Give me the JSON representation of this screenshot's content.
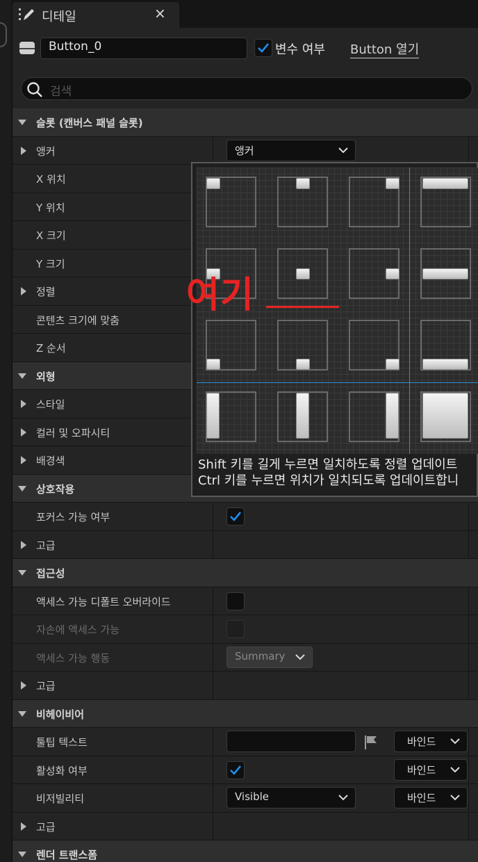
{
  "tab": {
    "title": "디테일",
    "close": "×"
  },
  "header": {
    "name_value": "Button_0",
    "is_variable_label": "변수 여부",
    "is_variable_checked": true,
    "open_link": "Button 열기"
  },
  "search": {
    "placeholder": "검색"
  },
  "rows": [
    {
      "label": "슬롯 (캔버스 패널 슬롯)",
      "kind": "category",
      "expanded": true
    },
    {
      "label": "앵커",
      "kind": "group",
      "control": "combo",
      "value": "앵커"
    },
    {
      "label": "X 위치",
      "kind": "prop"
    },
    {
      "label": "Y 위치",
      "kind": "prop"
    },
    {
      "label": "X 크기",
      "kind": "prop"
    },
    {
      "label": "Y 크기",
      "kind": "prop"
    },
    {
      "label": "정렬",
      "kind": "group"
    },
    {
      "label": "콘텐츠 크기에 맞춤",
      "kind": "prop"
    },
    {
      "label": "Z 순서",
      "kind": "prop"
    },
    {
      "label": "외형",
      "kind": "category",
      "expanded": true
    },
    {
      "label": "스타일",
      "kind": "group"
    },
    {
      "label": "컬러 및 오파시티",
      "kind": "group"
    },
    {
      "label": "배경색",
      "kind": "group"
    },
    {
      "label": "상호작용",
      "kind": "category",
      "expanded": true
    },
    {
      "label": "포커스 가능 여부",
      "kind": "prop",
      "control": "check",
      "checked": true
    },
    {
      "label": "고급",
      "kind": "group"
    },
    {
      "label": "접근성",
      "kind": "category",
      "expanded": true
    },
    {
      "label": "액세스 가능 디폴트 오버라이드",
      "kind": "prop",
      "control": "check",
      "checked": false
    },
    {
      "label": "자손에 액세스 가능",
      "kind": "prop",
      "dim": true,
      "control": "check-dim",
      "checked": false
    },
    {
      "label": "액세스 가능 행동",
      "kind": "prop",
      "dim": true,
      "control": "combo-dim",
      "value": "Summary"
    },
    {
      "label": "고급",
      "kind": "group"
    },
    {
      "label": "비헤이비어",
      "kind": "category",
      "expanded": true
    },
    {
      "label": "툴팁 텍스트",
      "kind": "prop",
      "control": "text-bind",
      "bind": "바인드"
    },
    {
      "label": "활성화 여부",
      "kind": "prop",
      "control": "check-bind",
      "checked": true,
      "bind": "바인드"
    },
    {
      "label": "비저빌리티",
      "kind": "prop",
      "control": "combo-bind",
      "value": "Visible",
      "bind": "바인드"
    },
    {
      "label": "고급",
      "kind": "group"
    },
    {
      "label": "렌더 트랜스폼",
      "kind": "category",
      "expanded": true
    }
  ],
  "anchor_popup": {
    "hint_line1": "Shift 키를 길게 누르면 일치하도록 정렬 업데이트",
    "hint_line2": "Ctrl 키를 누르면 위치가 일치되도록 업데이트합니",
    "annotation": "여기",
    "accent": "#2f8fd8"
  },
  "colors": {
    "accent_check": "#1e8ef0",
    "annotation_red": "#e52323"
  }
}
